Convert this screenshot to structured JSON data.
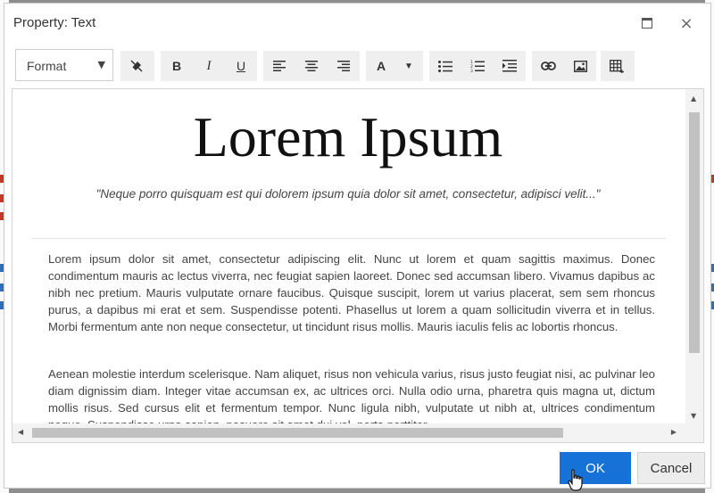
{
  "dialog": {
    "title": "Property: Text",
    "maximize_icon": "maximize-icon",
    "close_icon": "close-icon",
    "close_glyph": "×"
  },
  "toolbar": {
    "format_label": "Format",
    "font_color_label": "A",
    "buttons": [
      {
        "name": "clear-format",
        "icon": "eraser-icon"
      },
      {
        "name": "bold",
        "label": "B"
      },
      {
        "name": "italic",
        "label": "I"
      },
      {
        "name": "underline",
        "label": "U"
      },
      {
        "name": "align-left",
        "icon": "align-left-icon"
      },
      {
        "name": "align-center",
        "icon": "align-center-icon"
      },
      {
        "name": "align-right",
        "icon": "align-right-icon"
      },
      {
        "name": "font-color",
        "icon": "font-color-icon"
      },
      {
        "name": "bullet-list",
        "icon": "bullet-list-icon"
      },
      {
        "name": "numbered-list",
        "icon": "numbered-list-icon"
      },
      {
        "name": "indent",
        "icon": "indent-icon"
      },
      {
        "name": "link",
        "icon": "link-icon"
      },
      {
        "name": "image",
        "icon": "image-icon"
      },
      {
        "name": "table",
        "icon": "table-icon"
      }
    ]
  },
  "editor": {
    "heading": "Lorem Ipsum",
    "quote": "\"Neque porro quisquam est qui dolorem ipsum quia dolor sit amet, consectetur, adipisci velit...\"",
    "paragraph1": "Lorem ipsum dolor sit amet, consectetur adipiscing elit. Nunc ut lorem et quam sagittis maximus. Donec condimentum mauris ac lectus viverra, nec feugiat sapien laoreet. Donec sed accumsan libero. Vivamus dapibus ac nibh nec pretium. Mauris vulputate ornare faucibus. Quisque suscipit, lorem ut varius placerat, sem sem rhoncus purus, a dapibus mi erat et sem. Suspendisse potenti. Phasellus ut lorem a quam sollicitudin viverra et in tellus. Morbi fermentum ante non neque consectetur, ut tincidunt risus mollis. Mauris iaculis felis ac lobortis rhoncus.",
    "paragraph2": "Aenean molestie interdum scelerisque. Nam aliquet, risus non vehicula varius, risus justo feugiat nisi, ac pulvinar leo diam dignissim diam. Integer vitae accumsan ex, ac ultrices orci. Nulla odio urna, pharetra quis magna ut, dictum mollis risus. Sed cursus elit et fermentum tempor. Nunc ligula nibh, vulputate ut nibh at, ultrices condimentum neque. Suspendisse urna sapien, posuere sit amet dui vel, porta porttitor"
  },
  "footer": {
    "ok_label": "OK",
    "cancel_label": "Cancel"
  },
  "colors": {
    "accent": "#1672d6",
    "toolbar_group_bg": "#efefef",
    "overlay": "#8e8e8e"
  }
}
